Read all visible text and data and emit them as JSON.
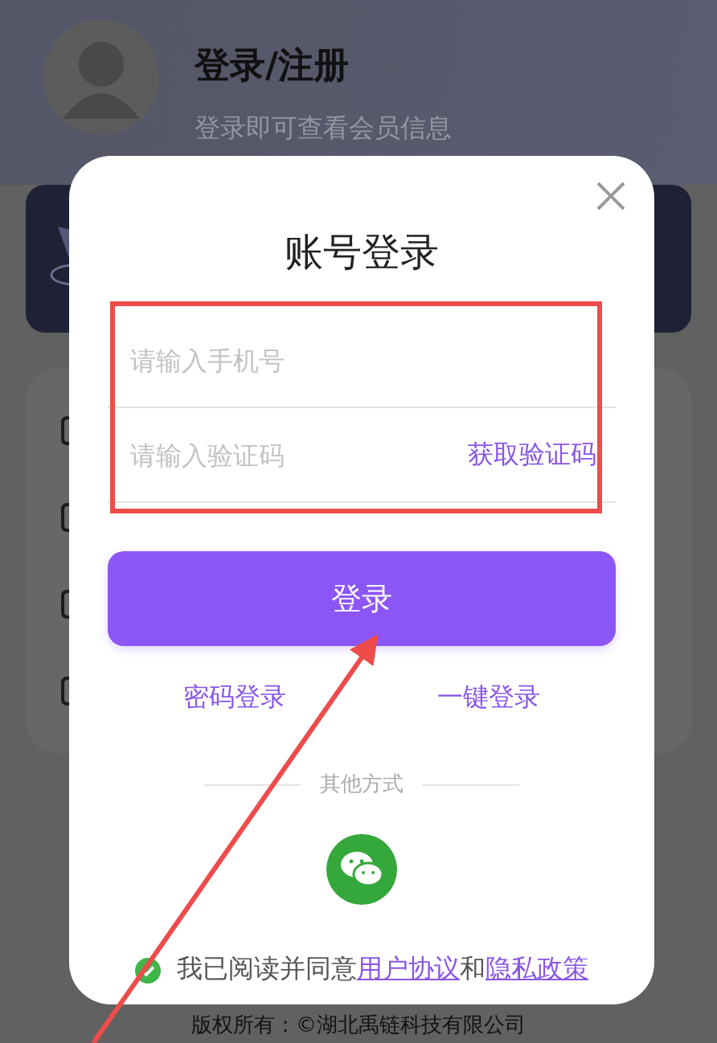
{
  "header": {
    "title": "登录/注册",
    "subtitle": "登录即可查看会员信息"
  },
  "dialog": {
    "title": "账号登录",
    "fields": [
      {
        "placeholder": "请输入手机号"
      },
      {
        "placeholder": "请输入验证码",
        "action": "获取验证码"
      }
    ],
    "submit": "登录",
    "links": [
      "密码登录",
      "一键登录"
    ],
    "divider": "其他方式",
    "agreement": {
      "checked": true,
      "text": "我已阅读并同意",
      "terms": "用户协议",
      "joiner": "和",
      "privacy": "隐私政策"
    }
  },
  "footer": "版权所有：©湖北禹链科技有限公司"
}
